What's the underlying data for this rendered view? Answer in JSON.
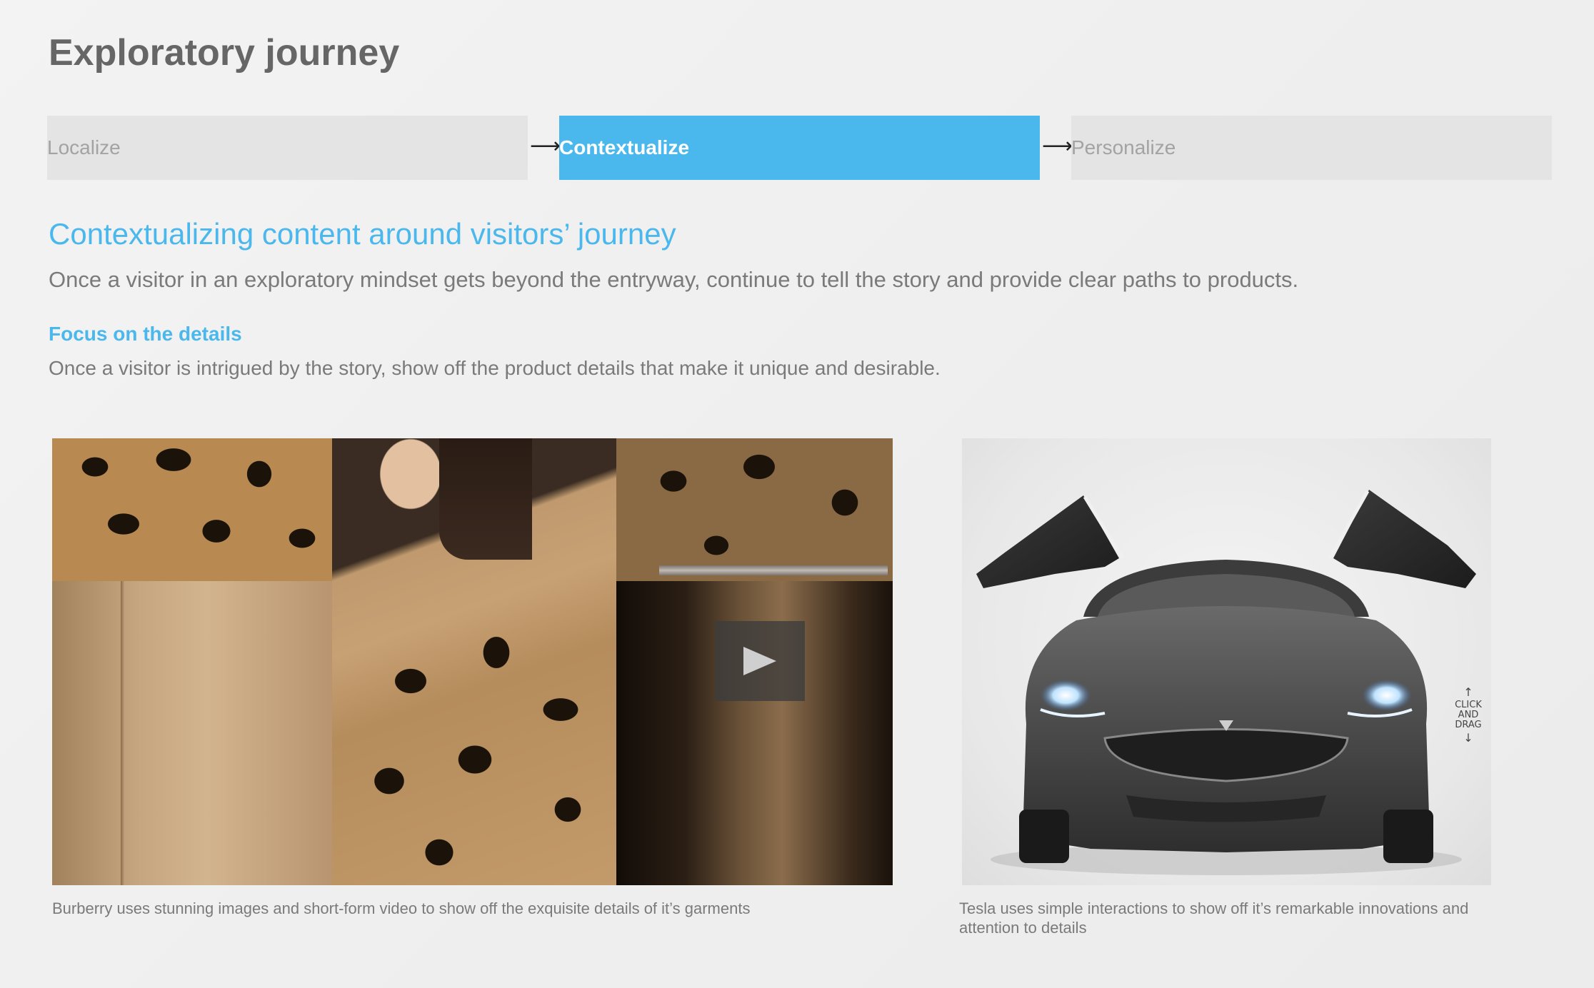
{
  "title": "Exploratory journey",
  "steps": [
    {
      "label": "Localize",
      "active": false
    },
    {
      "label": "Contextualize",
      "active": true
    },
    {
      "label": "Personalize",
      "active": false
    }
  ],
  "step_arrow": "⟶",
  "section": {
    "subtitle": "Contextualizing content around visitors’ journey",
    "lead": "Once a visitor in an exploratory mindset gets beyond the entryway, continue to tell the story and provide clear paths to products.",
    "focus_title": "Focus on the details",
    "focus_body": "Once a visitor is intrigued by the story, show off the product details that make it unique and desirable."
  },
  "examples": {
    "burberry_caption": "Burberry uses stunning images and short-form video to show off the exquisite details of it’s garments",
    "tesla_caption": "Tesla uses simple interactions to show off it’s remarkable innovations and attention to details",
    "drag_hint": {
      "line1": "CLICK",
      "line2": "AND",
      "line3": "DRAG"
    }
  },
  "colors": {
    "accent": "#4bb8ed",
    "inactive_step": "#e3e4e3",
    "text_gray": "#7a7a7a",
    "title_gray": "#666666"
  },
  "icons": {
    "play": "play-icon",
    "arrow": "arrow-right-icon",
    "drag_up": "arrow-up-icon",
    "drag_down": "arrow-down-icon"
  }
}
